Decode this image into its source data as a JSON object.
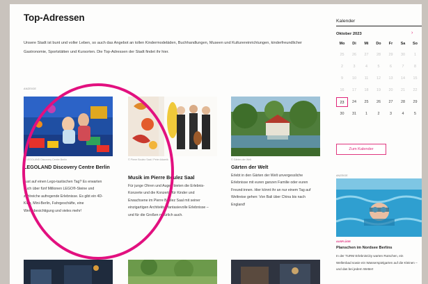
{
  "page": {
    "title": "Top-Adressen",
    "intro": "Unsere Stadt ist bunt und voller Leben, so auch das Angebot an tollen Kindermodeläden, Buchhandlungen, Museen und Kulturereinrichtungen, kinderfreundlicher Gastronomie, Sportstätten und Kursorten. Die Top-Adressen der Stadt findet ihr hier.",
    "ad_label": "Anzeige"
  },
  "cards": [
    {
      "credit": "© LEGOLAND Discovery Centre Berlin",
      "title": "LEGOLAND Discovery Centre Berlin",
      "text": "Lust auf einen Lego-tastischen Tag? Es erwarten euch über fünf Millionen LEGO®-Steine und zahlreiche aufregende Erlebnisse. Es gibt ein 4D-Kino, Mini-Berlin, Fahrgeschäfte, eine Werksbesichtigung und vieles mehr!"
    },
    {
      "credit": "© Pierre Boulez Saal / Peter Adamik",
      "title": "Musik im Pierre Boulez Saal",
      "text": "Für junge Ohren und Augen bieten die Erlebnis-Konzerte und die Konzerte für Kinder und Erwachsene im Pierre Boulez Saal mit seiner einzigartigen Architektur fantasievolle Erlebnisse – und für die Großen natürlich auch."
    },
    {
      "credit": "© Gärten der Welt",
      "title": "Gärten der Welt",
      "text": "Erlebt in den Gärten der Welt unvergessliche Erlebnisse mit euren ganzen Familie oder euren Freund:innen. Hier könnt ihr an nur einem Tag auf Weltreise gehen: Von Bali über China bis nach England!"
    }
  ],
  "calendar": {
    "heading": "Kalender",
    "month": "Oktober 2023",
    "next_icon": "arrow-right-icon",
    "weekdays": [
      "Mo",
      "Di",
      "Mi",
      "Do",
      "Fr",
      "Sa",
      "So"
    ],
    "weeks": [
      [
        "25",
        "26",
        "27",
        "28",
        "29",
        "30",
        "1"
      ],
      [
        "2",
        "3",
        "4",
        "5",
        "6",
        "7",
        "8"
      ],
      [
        "9",
        "10",
        "11",
        "12",
        "13",
        "14",
        "15"
      ],
      [
        "16",
        "17",
        "18",
        "19",
        "20",
        "21",
        "22"
      ],
      [
        "23",
        "24",
        "25",
        "26",
        "27",
        "28",
        "29"
      ],
      [
        "30",
        "31",
        "1",
        "2",
        "3",
        "4",
        "5"
      ]
    ],
    "button": "Zum Kalender"
  },
  "sidebar_card": {
    "ad_label": "Anzeige",
    "tag": "Ausflüge",
    "title": "Planschen im Nordsee Berlins",
    "text": "In der TURM ErlebnisCity warten Rutschen, ein Wellenbad sowie ein Wasserspielgarten auf die Kleinen – und das bei jedem Wetter!"
  },
  "colors": {
    "accent": "#e02479",
    "highlight_circle": "#e2107f"
  }
}
